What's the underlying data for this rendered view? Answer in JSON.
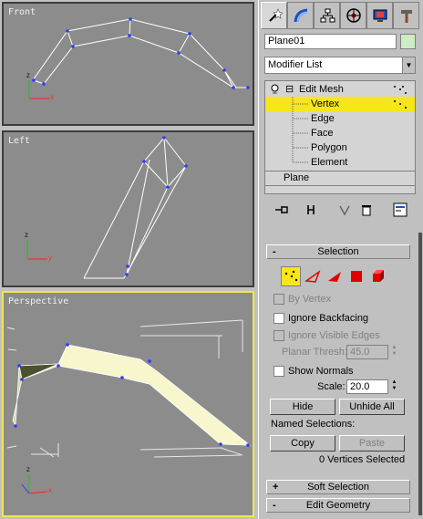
{
  "viewports": {
    "front": {
      "label": "Front"
    },
    "left": {
      "label": "Left"
    },
    "perspective": {
      "label": "Perspective"
    },
    "axis": {
      "x": "x",
      "y": "y",
      "z": "z"
    }
  },
  "tabs": [
    "create-tab",
    "modify-tab",
    "hierarchy-tab",
    "motion-tab",
    "display-tab",
    "utilities-tab"
  ],
  "object": {
    "name": "Plane01",
    "color": "#ccedc4"
  },
  "modifier_list": {
    "label": "Modifier List"
  },
  "stack": {
    "modifier": "Edit Mesh",
    "expand_symbol": "⊟",
    "subobjects": [
      "Vertex",
      "Edge",
      "Face",
      "Polygon",
      "Element"
    ],
    "selected": "Vertex",
    "base": "Plane"
  },
  "selection": {
    "title": "Selection",
    "collapse_symbol": "-",
    "by_vertex": "By Vertex",
    "ignore_backfacing": "Ignore Backfacing",
    "ignore_visible_edges": "Ignore Visible Edges",
    "planar_thresh_label": "Planar Thresh:",
    "planar_thresh_value": "45.0",
    "show_normals": "Show Normals",
    "scale_label": "Scale:",
    "scale_value": "20.0",
    "hide": "Hide",
    "unhide_all": "Unhide All",
    "named_selections": "Named Selections:",
    "copy": "Copy",
    "paste": "Paste",
    "status": "0 Vertices Selected"
  },
  "soft_selection": {
    "title": "Soft Selection",
    "symbol": "+"
  },
  "edit_geometry": {
    "title": "Edit Geometry",
    "symbol": "-"
  },
  "colors": {
    "accent": "#f7e619",
    "viewport_bg": "#8c8c8c",
    "vertex": "#2a3cff"
  }
}
